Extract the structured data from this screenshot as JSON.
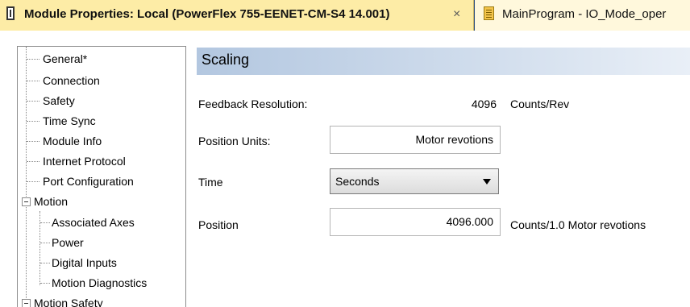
{
  "tabs": [
    {
      "title": "Module Properties: Local (PowerFlex 755-EENET-CM-S4 14.001)",
      "close": "×",
      "icon": "document-icon",
      "active": true
    },
    {
      "title": "MainProgram - IO_Mode_oper",
      "icon": "program-icon",
      "active": false
    }
  ],
  "tree": {
    "items": [
      {
        "label": "General*"
      },
      {
        "label": "Connection"
      },
      {
        "label": "Safety"
      },
      {
        "label": "Time Sync"
      },
      {
        "label": "Module Info"
      },
      {
        "label": "Internet Protocol"
      },
      {
        "label": "Port Configuration"
      },
      {
        "label": "Motion",
        "expanded": true
      },
      {
        "label": "Associated Axes"
      },
      {
        "label": "Power"
      },
      {
        "label": "Digital Inputs"
      },
      {
        "label": "Motion Diagnostics"
      },
      {
        "label": "Motion Safety",
        "expanded": true
      }
    ]
  },
  "scaling": {
    "title": "Scaling",
    "feedback_resolution": {
      "label": "Feedback Resolution:",
      "value": "4096",
      "unit": "Counts/Rev"
    },
    "position_units": {
      "label": "Position Units:",
      "value": "Motor revotions"
    },
    "time": {
      "label": "Time",
      "selected": "Seconds"
    },
    "position": {
      "label": "Position",
      "value": "4096.000",
      "unit": "Counts/1.0 Motor revotions"
    }
  },
  "colors": {
    "tab_active_bg": "#fdeca6",
    "tabbar_bg": "#2b4d7d",
    "header_gradient_start": "#b3c7e0"
  }
}
